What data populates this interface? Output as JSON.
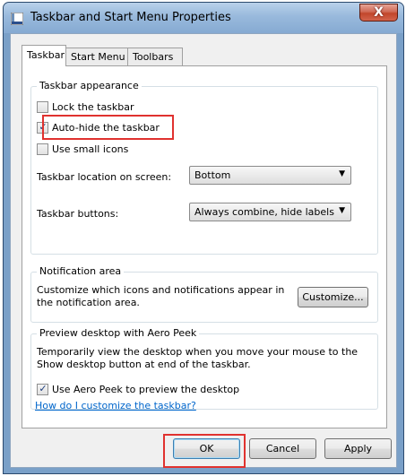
{
  "window": {
    "title": "Taskbar and Start Menu Properties"
  },
  "tabs": [
    {
      "label": "Taskbar"
    },
    {
      "label": "Start Menu"
    },
    {
      "label": "Toolbars"
    }
  ],
  "taskbar_appearance": {
    "group_label": "Taskbar appearance",
    "lock_taskbar": {
      "label": "Lock the taskbar",
      "checked": false
    },
    "auto_hide": {
      "label": "Auto-hide the taskbar",
      "checked": true
    },
    "small_icons": {
      "label": "Use small icons",
      "checked": false
    },
    "location_label": "Taskbar location on screen:",
    "location_value": "Bottom",
    "buttons_label": "Taskbar buttons:",
    "buttons_value": "Always combine, hide labels"
  },
  "notification_area": {
    "group_label": "Notification area",
    "description_line1": "Customize which icons and notifications appear in",
    "description_line2": "the notification area.",
    "customize_label": "Customize..."
  },
  "aero_peek": {
    "group_label": "Preview desktop with Aero Peek",
    "description_line1": "Temporarily view the desktop when you move your mouse to the",
    "description_line2": "Show desktop button at end of the taskbar.",
    "use_aero_peek": {
      "label": "Use Aero Peek to preview the desktop",
      "checked": true
    }
  },
  "help_link": "How do I customize the taskbar?",
  "footer": {
    "ok_label": "OK",
    "cancel_label": "Cancel",
    "apply_label": "Apply"
  },
  "checkmark": "✓",
  "close_glyph": "X",
  "dropdown_arrow": "▼",
  "colors": {
    "highlight": "#e0322f",
    "link": "#0066cc",
    "title_bar": "#98b9dc"
  }
}
